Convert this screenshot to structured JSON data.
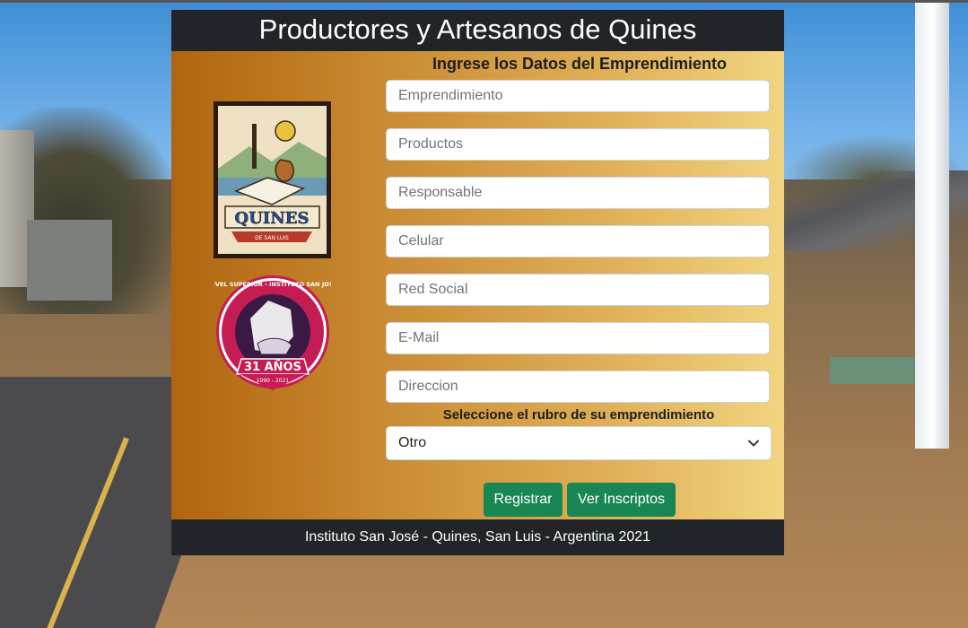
{
  "header": {
    "title": "Productores y Artesanos de Quines"
  },
  "form": {
    "title": "Ingrese los Datos del Emprendimiento",
    "fields": [
      {
        "placeholder": "Emprendimiento"
      },
      {
        "placeholder": "Productos"
      },
      {
        "placeholder": "Responsable"
      },
      {
        "placeholder": "Celular"
      },
      {
        "placeholder": "Red Social"
      },
      {
        "placeholder": "E-Mail"
      },
      {
        "placeholder": "Direccion"
      }
    ],
    "select_label": "Seleccione el rubro de su emprendimiento",
    "select_value": "Otro",
    "register_label": "Registrar",
    "view_label": "Ver Inscriptos"
  },
  "logos": {
    "quines_text": "QUINES",
    "quines_subtext": "DE SAN LUIS",
    "institute_ring": "NIVEL SUPERIOR - INSTITUTO SAN JOSE",
    "institute_years": "31 AÑOS",
    "institute_dates": "1990 - 2021"
  },
  "footer": {
    "text": "Instituto San José - Quines, San Luis - Argentina 2021"
  },
  "colors": {
    "header_bg": "#212529",
    "button_bg": "#198754",
    "gradient_start": "#b1640f",
    "gradient_end": "#f2d480"
  }
}
